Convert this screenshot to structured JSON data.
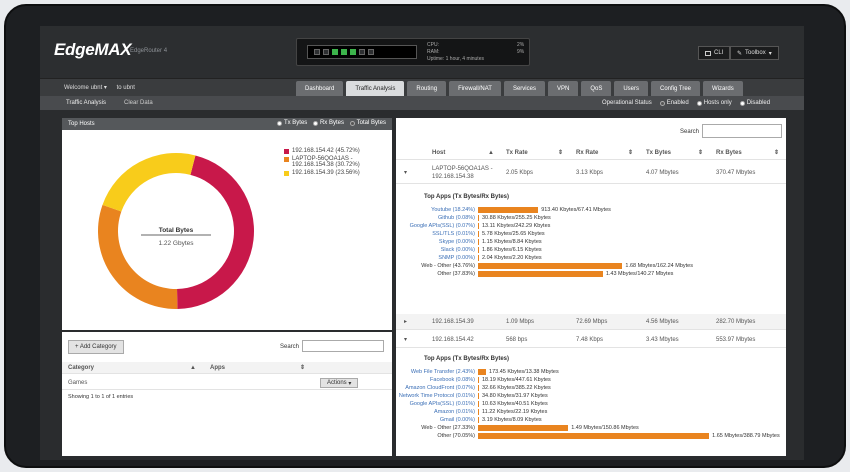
{
  "app": {
    "logo": "EdgeMAX",
    "model": "EdgeRouter 4"
  },
  "status": {
    "cpu_label": "CPU:",
    "ram_label": "RAM:",
    "uptime_label": "Uptime:",
    "cpu": "2%",
    "ram": "9%",
    "uptime": "1 hour, 4 minutes"
  },
  "header": {
    "cli": "CLI",
    "toolbox": "Toolbox"
  },
  "nav": {
    "welcome": "Welcome ubnt",
    "user": "to ubnt",
    "tabs": [
      "Dashboard",
      "Traffic Analysis",
      "Routing",
      "Firewall/NAT",
      "Services",
      "VPN",
      "QoS",
      "Users",
      "Config Tree",
      "Wizards"
    ],
    "active": 1
  },
  "subbar": {
    "title": "Traffic Analysis",
    "clear": "Clear Data",
    "op_status": "Operational Status",
    "enabled": "Enabled",
    "hosts_only": "Hosts only",
    "disabled": "Disabled"
  },
  "top_hosts": {
    "title": "Top Hosts",
    "opts": [
      "Tx Bytes",
      "Rx Bytes",
      "Total Bytes"
    ],
    "center_title": "Total Bytes",
    "center_value": "1.22 Gbytes",
    "legend": [
      {
        "label": "192.168.154.42 (45.72%)",
        "color": "#c8184a"
      },
      {
        "label": "LAPTOP-56QOA1AS - 192.168.154.38 (30.72%)",
        "color": "#e9841f"
      },
      {
        "label": "192.168.154.39 (23.56%)",
        "color": "#f8cc1b"
      }
    ],
    "slices": [
      45.72,
      30.72,
      23.56
    ]
  },
  "category": {
    "add": "+ Add Category",
    "search": "Search",
    "col_category": "Category",
    "col_apps": "Apps",
    "rows": [
      {
        "name": "Games",
        "action": "Actions"
      }
    ],
    "footer": "Showing 1 to 1 of 1 entries"
  },
  "hosts_table": {
    "search": "Search",
    "cols": [
      "Host",
      "Tx Rate",
      "Rx Rate",
      "Tx Bytes",
      "Rx Bytes"
    ],
    "top_apps_title": "Top Apps (Tx Bytes/Rx Bytes)",
    "rows": [
      {
        "host": "LAPTOP-56QOA1AS - 192.168.154.38",
        "tx_rate": "2.05 Kbps",
        "rx_rate": "3.13 Kbps",
        "tx_bytes": "4.07 Mbytes",
        "rx_bytes": "370.47 Mbytes"
      },
      {
        "host": "192.168.154.39",
        "tx_rate": "1.09 Mbps",
        "rx_rate": "72.69 Mbps",
        "tx_bytes": "4.56 Mbytes",
        "rx_bytes": "282.70 Mbytes"
      },
      {
        "host": "192.168.154.42",
        "tx_rate": "568 bps",
        "rx_rate": "7.48 Kbps",
        "tx_bytes": "3.43 Mbytes",
        "rx_bytes": "553.97 Mbytes"
      }
    ],
    "apps1": [
      {
        "name": "Youtube (18.24%)",
        "value": "913.40 Kbytes/67.41 Mbytes",
        "pct": 18.24,
        "link": true
      },
      {
        "name": "Github (0.08%)",
        "value": "30.88 Kbytes/255.25 Kbytes",
        "pct": 0.08,
        "link": true
      },
      {
        "name": "Google APIs(SSL) (0.07%)",
        "value": "13.11 Kbytes/242.29 Kbytes",
        "pct": 0.07,
        "link": true
      },
      {
        "name": "SSL/TLS (0.01%)",
        "value": "5.78 Kbytes/25.65 Kbytes",
        "pct": 0.01,
        "link": true
      },
      {
        "name": "Skype (0.00%)",
        "value": "1.15 Kbytes/8.84 Kbytes",
        "pct": 0,
        "link": true
      },
      {
        "name": "Slack (0.00%)",
        "value": "1.86 Kbytes/6.15 Kbytes",
        "pct": 0,
        "link": true
      },
      {
        "name": "SNMP (0.00%)",
        "value": "2.04 Kbytes/2.20 Kbytes",
        "pct": 0,
        "link": true
      },
      {
        "name": "Web - Other (43.76%)",
        "value": "1.68 Mbytes/162.24 Mbytes",
        "pct": 43.76,
        "link": false
      },
      {
        "name": "Other (37.83%)",
        "value": "1.43 Mbytes/140.27 Mbytes",
        "pct": 37.83,
        "link": false
      }
    ],
    "apps2": [
      {
        "name": "Web File Transfer (2.43%)",
        "value": "173.45 Kbytes/13.38 Mbytes",
        "pct": 2.43,
        "link": true
      },
      {
        "name": "Facebook (0.08%)",
        "value": "18.19 Kbytes/447.61 Kbytes",
        "pct": 0.08,
        "link": true
      },
      {
        "name": "Amazon CloudFront (0.07%)",
        "value": "32.66 Kbytes/385.22 Kbytes",
        "pct": 0.07,
        "link": true
      },
      {
        "name": "Network Time Protocol (0.01%)",
        "value": "34.80 Kbytes/31.97 Kbytes",
        "pct": 0.01,
        "link": true
      },
      {
        "name": "Google APIs(SSL) (0.01%)",
        "value": "10.63 Kbytes/40.51 Kbytes",
        "pct": 0.01,
        "link": true
      },
      {
        "name": "Amazon (0.01%)",
        "value": "11.22 Kbytes/22.19 Kbytes",
        "pct": 0.01,
        "link": true
      },
      {
        "name": "Gmail (0.00%)",
        "value": "3.19 Kbytes/8.09 Kbytes",
        "pct": 0,
        "link": true
      },
      {
        "name": "Web - Other (27.33%)",
        "value": "1.49 Mbytes/150.86 Mbytes",
        "pct": 27.33,
        "link": false
      },
      {
        "name": "Other (70.05%)",
        "value": "1.65 Mbytes/388.79 Mbytes",
        "pct": 70.05,
        "link": false
      }
    ]
  }
}
